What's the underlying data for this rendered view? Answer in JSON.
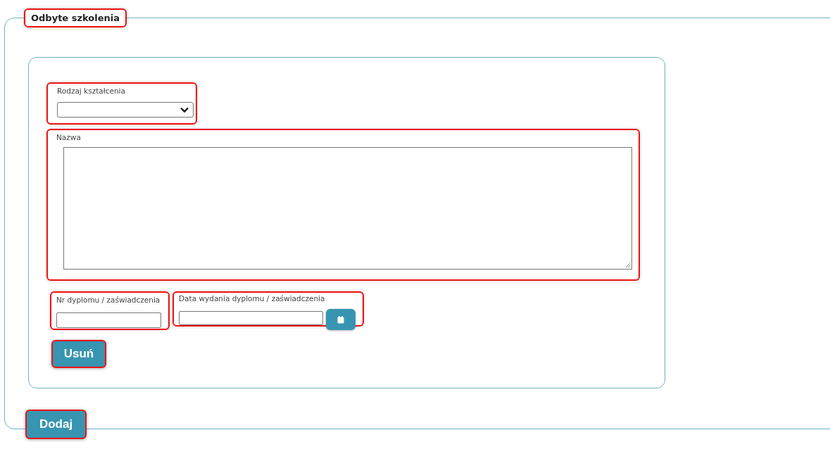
{
  "section": {
    "title": "Odbyte szkolenia"
  },
  "form": {
    "fields": [
      {
        "kind": "select",
        "label": "Rodzaj kształcenia"
      },
      {
        "kind": "textarea",
        "label": "Nazwa"
      },
      {
        "kind": "text",
        "label": "Nr dyplomu / zaświadczenia"
      },
      {
        "kind": "date",
        "label": "Data wydania dyplomu / zaświadczenia"
      }
    ],
    "remove_button": "Usuń"
  },
  "add_button": "Dodaj"
}
